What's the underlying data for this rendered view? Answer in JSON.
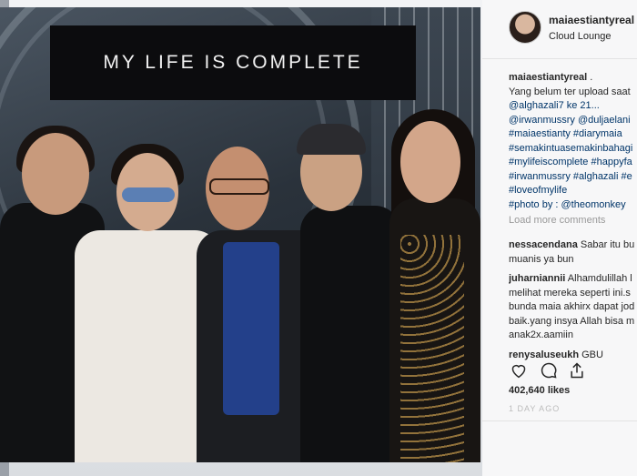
{
  "photo": {
    "title_text": "MY LIFE IS COMPLETE"
  },
  "post": {
    "username": "maiaestiantyreal",
    "location": "Cloud Lounge",
    "caption_user": "maiaestiantyreal",
    "caption_user_suffix": " .",
    "caption_lines": [
      "Yang belum ter upload saat",
      "@alghazali7 ke 21...",
      "@irwanmussry @duljaelani",
      "#maiaestianty #diarymaia",
      "#semakintuasemakinbahagi",
      "#mylifeiscomplete #happyfa",
      "#irwanmussry #alghazali #e",
      "#loveofmylife",
      "#photo by : @theomonkey"
    ],
    "load_more": "Load more comments",
    "comments": [
      {
        "user": "nessacendana",
        "text_first": " Sabar itu bu",
        "text_rest": [
          "muanis ya bun"
        ]
      },
      {
        "user": "juharniannii",
        "text_first": " Alhamdulillah l",
        "text_rest": [
          "melihat mereka seperti ini.s",
          "bunda maia akhirx dapat jod",
          "baik.yang insya Allah bisa m",
          "anak2x.aamiin"
        ]
      },
      {
        "user": "renysaluseukh",
        "text_first": " GBU",
        "text_rest": []
      }
    ],
    "likes": "402,640 likes",
    "time_ago": "1 DAY AGO"
  },
  "icons": [
    "heart-icon",
    "comment-icon",
    "share-icon"
  ]
}
